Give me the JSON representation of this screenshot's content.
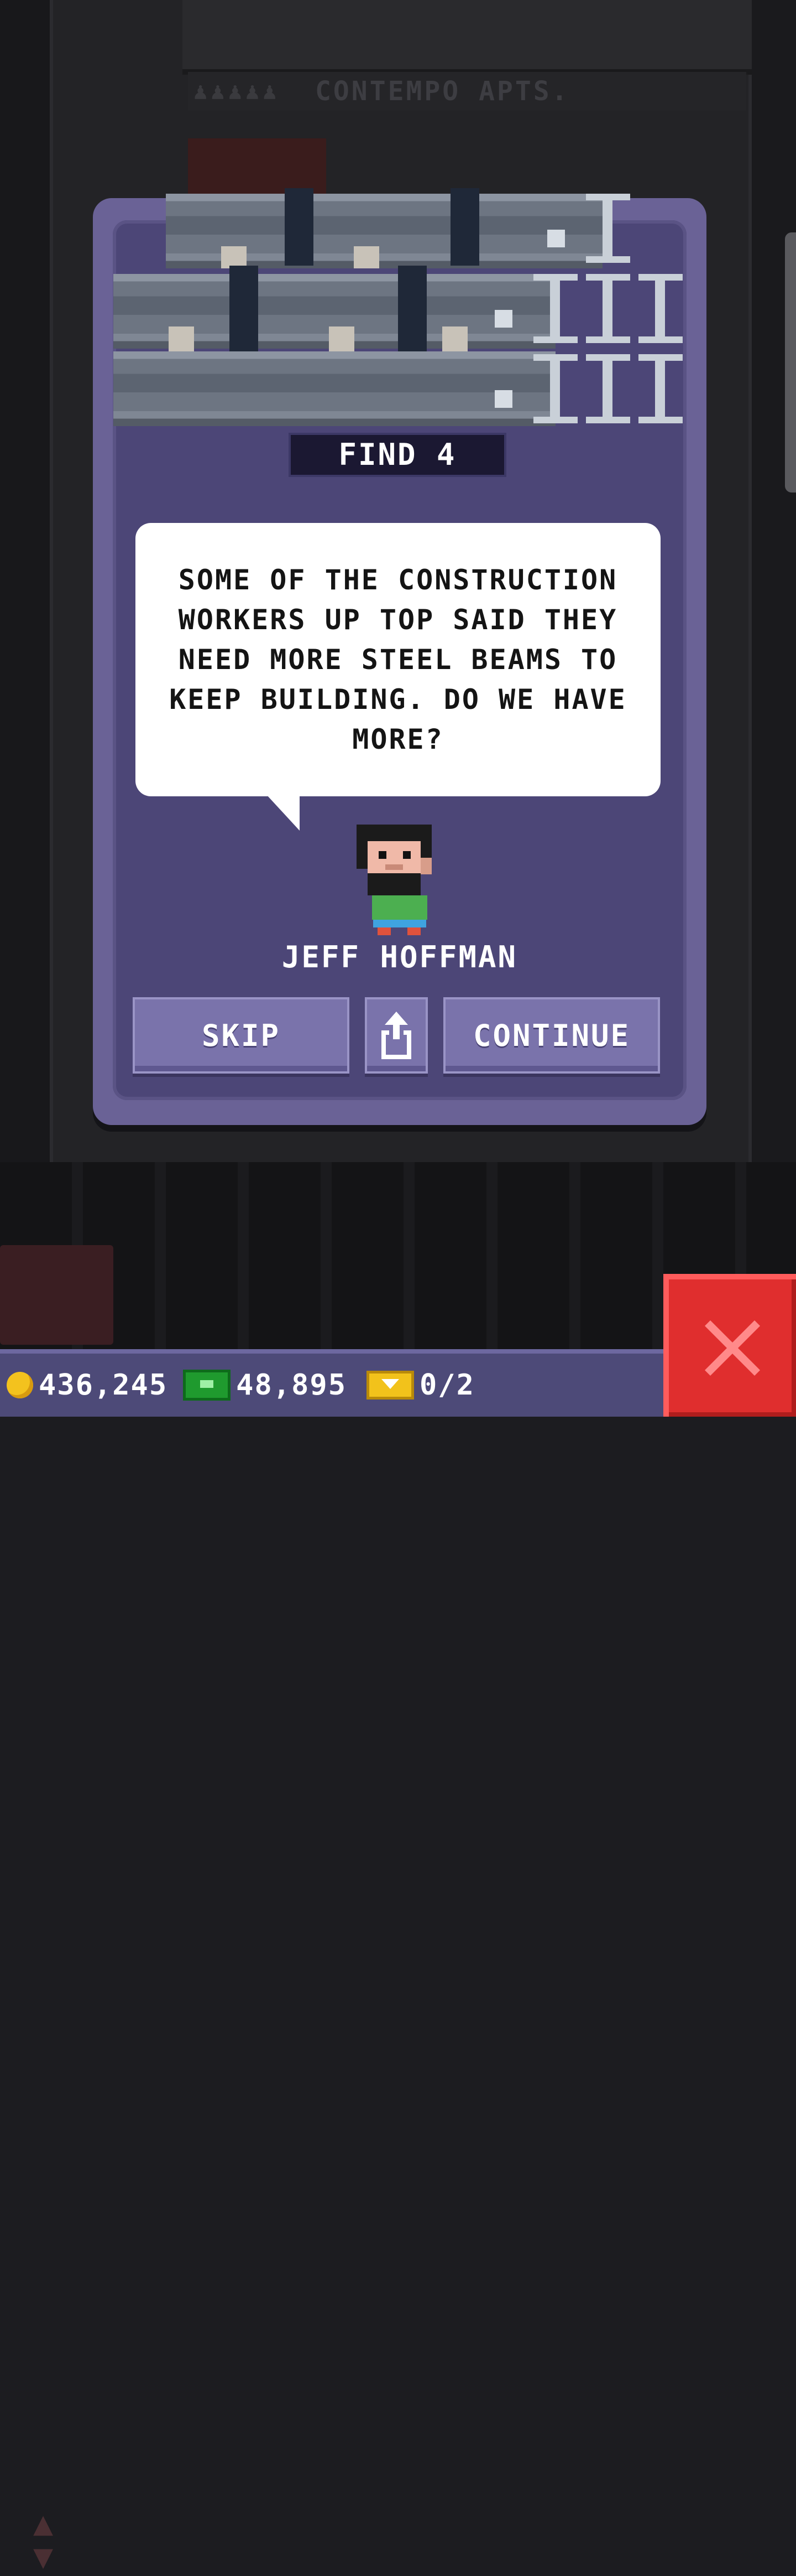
{
  "background": {
    "building_name": "CONTEMPO APTS."
  },
  "mission": {
    "find_label": "FIND 4",
    "dialog": "SOME OF THE CONSTRUCTION WORKERS UP TOP SAID THEY NEED MORE STEEL BEAMS TO KEEP BUILDING. DO WE HAVE MORE?",
    "character_name": "JEFF HOFFMAN",
    "item_icon": "steel-beams-icon"
  },
  "buttons": {
    "skip": "SKIP",
    "share_icon": "share-icon",
    "continue": "CONTINUE"
  },
  "status": {
    "coins": "436,245",
    "coins_icon": "coin-icon",
    "cash": "48,895",
    "cash_icon": "cash-icon",
    "bux": "0/2",
    "bux_icon": "bux-icon"
  },
  "close_icon": "close-icon",
  "colors": {
    "card": "#6a6296",
    "card_inner": "#4c4677",
    "button": "#7a73ab",
    "close": "#e02e2e",
    "statusbar": "#4d4a78"
  }
}
